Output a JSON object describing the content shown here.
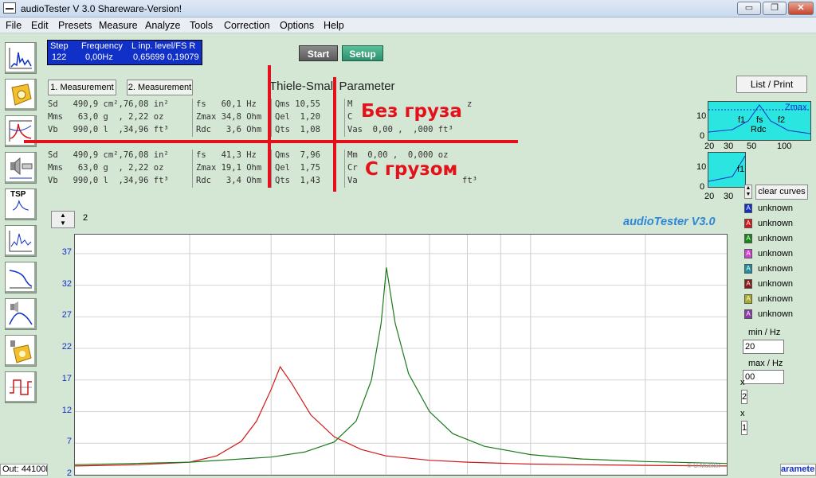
{
  "window": {
    "title": "audioTester  V 3.0 Shareware-Version!",
    "min": "▭",
    "max": "❐",
    "close": "✕"
  },
  "menu": [
    "File",
    "Edit",
    "Presets",
    "Measure",
    "Analyze",
    "Tools",
    "Correction",
    "Options",
    "Help"
  ],
  "toolbar": [
    {
      "icon": "fft-spectrum-icon"
    },
    {
      "icon": "speaker-cone-icon"
    },
    {
      "icon": "impedance-plot-icon"
    },
    {
      "icon": "speaker-measure-icon"
    },
    {
      "icon": "tsp-icon",
      "label": "TSP"
    },
    {
      "icon": "frequency-response-icon"
    },
    {
      "icon": "filter-curve-icon"
    },
    {
      "icon": "speaker-filter-icon"
    },
    {
      "icon": "speaker-cone-icon"
    },
    {
      "icon": "waveform-icon"
    }
  ],
  "stepbox": {
    "h1": "Step",
    "h2": "Frequency",
    "h3": "L  inp. level/FS  R",
    "v1": "122",
    "v2": "0,00Hz",
    "v3": "0,65699 0,19079"
  },
  "buttons": {
    "start": "Start",
    "setup": "Setup",
    "list_print": "List / Print",
    "clear_curves": "clear curves"
  },
  "tsp": {
    "tab1": "1. Measurement",
    "tab2": "2. Measurement",
    "title": "Thiele-Small Parameter",
    "m1": [
      [
        "Sd   490,9 cm²,76,08 in²",
        "fs   60,1 Hz",
        "Qms 10,55",
        "M",
        "z"
      ],
      [
        "Mms   63,0 g  , 2,22 oz",
        "Zmax 34,8 Ohm",
        "Qel  1,20",
        "C",
        ""
      ],
      [
        "Vb   990,0 l  ,34,96 ft³",
        "Rdc   3,6 Ohm",
        "Qts  1,08",
        "Vas  0,00 ,  ,000 ft³",
        ""
      ]
    ],
    "m2": [
      [
        "Sd   490,9 cm²,76,08 in²",
        "fs   41,3 Hz",
        "Qms  7,96",
        "Mm  0,00 ,  0,000 oz",
        ""
      ],
      [
        "Mms   63,0 g  , 2,22 oz",
        "Zmax 19,1 Ohm",
        "Qel  1,75",
        "Cr",
        ""
      ],
      [
        "Vb   990,0 l  ,34,96 ft³",
        "Rdc   3,4 Ohm",
        "Qts  1,43",
        "Va",
        "ft³"
      ]
    ]
  },
  "overlay": {
    "label_top": "Без груза",
    "label_bottom": "С грузом"
  },
  "mini1": {
    "labels": [
      "Zmax",
      "f1",
      "fs",
      "f2",
      "Rdc"
    ],
    "y": [
      "10",
      "0"
    ],
    "x": [
      "20",
      "30",
      "50",
      "100"
    ]
  },
  "mini2": {
    "labels": [
      "f1"
    ],
    "y": [
      "10",
      "0"
    ],
    "x": [
      "20",
      "30"
    ]
  },
  "curves": [
    {
      "color": "#1030c8",
      "label": "unknown"
    },
    {
      "color": "#d01818",
      "label": "unknown"
    },
    {
      "color": "#118811",
      "label": "unknown"
    },
    {
      "color": "#d040d0",
      "label": "unknown"
    },
    {
      "color": "#1a8f9f",
      "label": "unknown"
    },
    {
      "color": "#8a1a1a",
      "label": "unknown"
    },
    {
      "color": "#aaaa22",
      "label": "unknown"
    },
    {
      "color": "#8a3aa8",
      "label": "unknown"
    }
  ],
  "range": {
    "min_label": "min / Hz",
    "min_value": "20",
    "max_label": "max / Hz",
    "max_value": "00"
  },
  "extra_inputs": [
    "x",
    "2",
    "x",
    "1"
  ],
  "graph": {
    "curve_count": "2",
    "brand": "audioTester  V3.0",
    "copyright": "© U.Mueller"
  },
  "status": {
    "left": "Out: 44100H",
    "right": "arameter"
  },
  "chart_data": {
    "type": "line",
    "title": "",
    "xlabel": "",
    "ylabel": "",
    "yticks": [
      2,
      7,
      12,
      17,
      22,
      27,
      32,
      37
    ],
    "ylim": [
      2,
      40
    ],
    "xlim": [
      20,
      200
    ],
    "grid": true,
    "series": [
      {
        "color": "#d01818",
        "x": [
          20,
          25,
          30,
          33,
          36,
          38,
          40,
          41.3,
          43,
          46,
          50,
          55,
          60,
          70,
          80,
          100,
          120,
          150,
          200
        ],
        "y": [
          3.4,
          3.6,
          4.0,
          5.0,
          7.3,
          10.5,
          15.5,
          19.1,
          16.5,
          11.5,
          8.0,
          6.0,
          5.0,
          4.3,
          4.0,
          3.7,
          3.6,
          3.5,
          3.4
        ]
      },
      {
        "color": "#1a7a1a",
        "x": [
          20,
          30,
          40,
          45,
          50,
          54,
          57,
          59,
          60.1,
          62,
          65,
          70,
          76,
          85,
          100,
          120,
          150,
          200
        ],
        "y": [
          3.6,
          4.0,
          4.8,
          5.6,
          7.2,
          10.5,
          17.0,
          26.0,
          34.8,
          26.0,
          18.0,
          12.0,
          8.5,
          6.5,
          5.2,
          4.5,
          4.1,
          3.8
        ]
      }
    ]
  }
}
